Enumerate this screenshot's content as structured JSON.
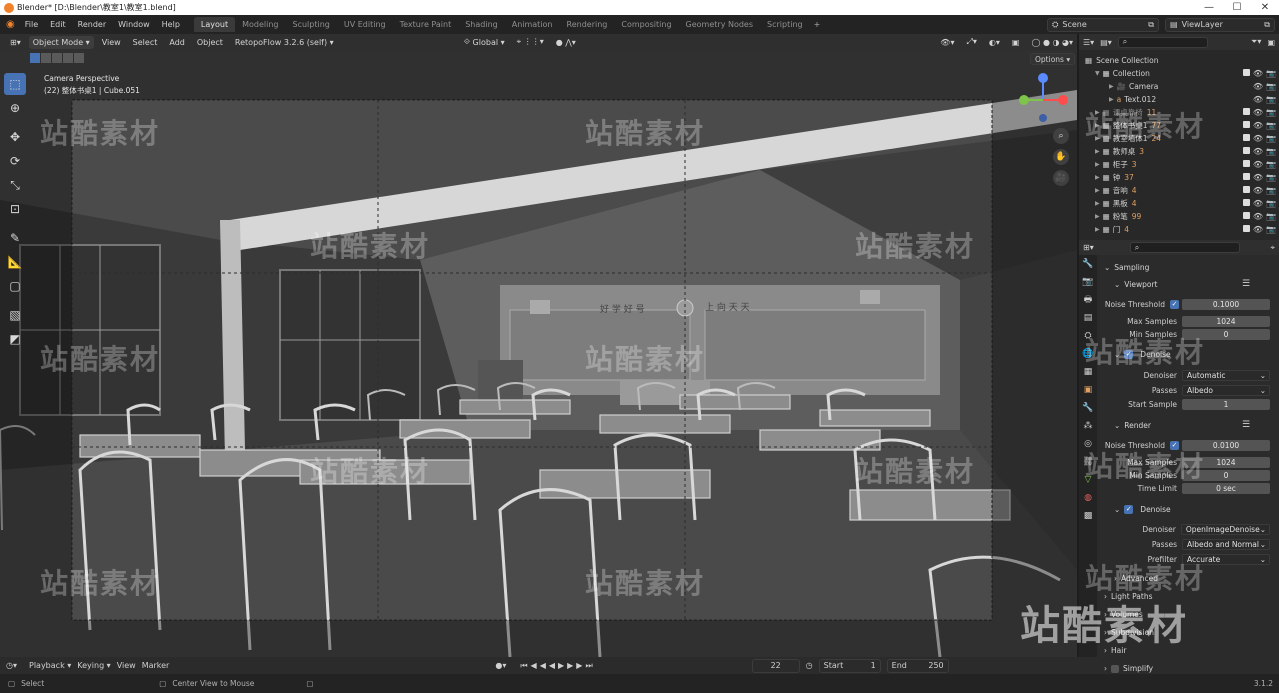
{
  "window": {
    "title": "Blender* [D:\\Blender\\教室1\\教室1.blend]"
  },
  "menu": [
    "File",
    "Edit",
    "Render",
    "Window",
    "Help"
  ],
  "workspaces": [
    "Layout",
    "Modeling",
    "Sculpting",
    "UV Editing",
    "Texture Paint",
    "Shading",
    "Animation",
    "Rendering",
    "Compositing",
    "Geometry Nodes",
    "Scripting"
  ],
  "active_workspace": "Layout",
  "scene": {
    "name": "Scene",
    "view_layer": "ViewLayer"
  },
  "viewport_header": {
    "mode": "Object Mode",
    "menus": [
      "View",
      "Select",
      "Add",
      "Object"
    ],
    "addon": "RetopoFlow 3.2.6 (self)",
    "orientation": "Global",
    "options": "Options"
  },
  "viewport_overlay": {
    "line1": "Camera Perspective",
    "line2": "(22) 整体书桌1 | Cube.051"
  },
  "scene_text": {
    "banner": "上 向 天 天",
    "board_left": "好 学 好 号"
  },
  "watermark": "站酷素材",
  "outliner": {
    "root": "Scene Collection",
    "items": [
      {
        "label": "Collection",
        "indent": 1
      },
      {
        "label": "Camera",
        "indent": 2
      },
      {
        "label": "Text.012",
        "indent": 2
      },
      {
        "label": "课桌靠椅",
        "indent": 1,
        "count": "11"
      },
      {
        "label": "整体书桌1",
        "indent": 1,
        "count": "77"
      },
      {
        "label": "教室墙体1",
        "indent": 1,
        "count": "24"
      },
      {
        "label": "教师桌",
        "indent": 1,
        "count": "3"
      },
      {
        "label": "柜子",
        "indent": 1,
        "count": "3"
      },
      {
        "label": "钟",
        "indent": 1,
        "count": "37"
      },
      {
        "label": "音响",
        "indent": 1,
        "count": "4"
      },
      {
        "label": "黑板",
        "indent": 1,
        "count": "4"
      },
      {
        "label": "粉笔",
        "indent": 1,
        "count": "99"
      },
      {
        "label": "门",
        "indent": 1,
        "count": "4"
      }
    ]
  },
  "properties": {
    "sampling": "Sampling",
    "viewport_panel": "Viewport",
    "render_panel": "Render",
    "noise_threshold_label": "Noise Threshold",
    "max_samples_label": "Max Samples",
    "min_samples_label": "Min Samples",
    "denoise_label": "Denoise",
    "denoiser_label": "Denoiser",
    "passes_label": "Passes",
    "start_sample_label": "Start Sample",
    "time_limit_label": "Time Limit",
    "prefilter_label": "Prefilter",
    "vp_noise": "0.1000",
    "vp_max": "1024",
    "vp_min": "0",
    "vp_denoiser": "Automatic",
    "vp_passes": "Albedo",
    "vp_start": "1",
    "r_noise": "0.0100",
    "r_max": "1024",
    "r_min": "0",
    "r_time": "0 sec",
    "r_denoiser": "OpenImageDenoise",
    "r_passes": "Albedo and Normal",
    "r_prefilter": "Accurate",
    "collapsed": [
      "Advanced",
      "Light Paths",
      "Volumes",
      "Subdivision",
      "Hair",
      "Simplify"
    ]
  },
  "timeline": {
    "menus": [
      "Playback",
      "Keying",
      "View",
      "Marker"
    ],
    "current_frame": "22",
    "start_label": "Start",
    "start": "1",
    "end_label": "End",
    "end": "250"
  },
  "status": {
    "left": "Select",
    "middle": "Center View to Mouse",
    "version": "3.1.2"
  },
  "colors": {
    "accent": "#4772b3",
    "bg": "#1d1d1d",
    "header": "#2f2f2f"
  }
}
